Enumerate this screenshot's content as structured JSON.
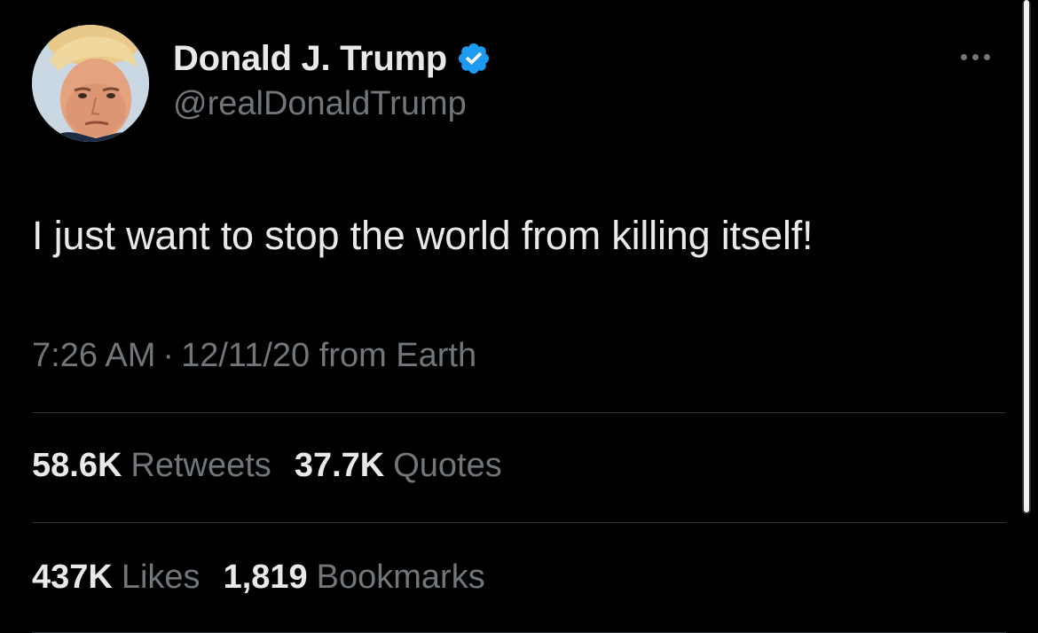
{
  "tweet": {
    "author": {
      "display_name": "Donald J. Trump",
      "handle": "@realDonaldTrump",
      "verified": true,
      "verified_color": "#1d9bf0"
    },
    "text": "I just want to stop the world from killing itself!",
    "time": "7:26 AM",
    "separator": "·",
    "date": "12/11/20",
    "source": "from Earth"
  },
  "stats": {
    "retweets": {
      "count": "58.6K",
      "label": "Retweets"
    },
    "quotes": {
      "count": "37.7K",
      "label": "Quotes"
    },
    "likes": {
      "count": "437K",
      "label": "Likes"
    },
    "bookmarks": {
      "count": "1,819",
      "label": "Bookmarks"
    }
  },
  "icons": {
    "more": "more-icon",
    "verified": "verified-badge-icon"
  },
  "colors": {
    "background": "#000000",
    "text_primary": "#e7e9ea",
    "text_secondary": "#71767b",
    "divider": "#2f3336"
  }
}
